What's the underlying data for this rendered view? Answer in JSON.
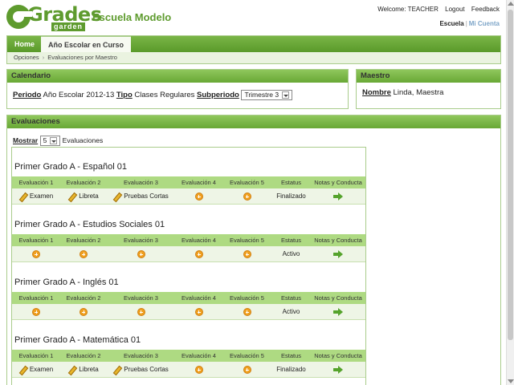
{
  "header": {
    "logo_word": "Grades",
    "logo_sub": "garden",
    "school_name": "Escuela Modelo",
    "welcome": "Welcome: TEACHER",
    "logout": "Logout",
    "feedback": "Feedback",
    "account_current": "Escuela",
    "account_separator": "|",
    "account_other": "Mi Cuenta"
  },
  "nav": {
    "tabs": [
      "Home",
      "Año Escolar en Curso"
    ],
    "breadcrumbs": [
      "Opciones",
      "Evaluaciones por Maestro"
    ],
    "crumb_arrow": "›"
  },
  "calendario": {
    "title": "Calendario",
    "periodo_label": "Periodo",
    "periodo_value": "Año Escolar 2012-13",
    "tipo_label": "Tipo",
    "tipo_value": "Clases Regulares",
    "subperiodo_label": "Subperiodo",
    "subperiodo_value": "Trimestre 3"
  },
  "maestro": {
    "title": "Maestro",
    "nombre_label": "Nombre",
    "nombre_value": "Linda, Maestra"
  },
  "evaluaciones": {
    "title": "Evaluaciones",
    "mostrar_label": "Mostrar",
    "mostrar_value": "5",
    "mostrar_suffix": "Evaluaciones",
    "columns": [
      "Evaluación 1",
      "Evaluación 2",
      "Evaluación 3",
      "Evaluación 4",
      "Evaluación 5",
      "Estatus",
      "Notas y Conducta"
    ],
    "courses": [
      {
        "title": "Primer Grado A - Español 01",
        "cells": [
          {
            "type": "text",
            "text": "Examen"
          },
          {
            "type": "text",
            "text": "Libreta"
          },
          {
            "type": "text",
            "text": "Pruebas Cortas"
          },
          {
            "type": "add"
          },
          {
            "type": "add"
          }
        ],
        "status": "Finalizado"
      },
      {
        "title": "Primer Grado A - Estudios Sociales 01",
        "cells": [
          {
            "type": "add"
          },
          {
            "type": "add"
          },
          {
            "type": "add"
          },
          {
            "type": "add"
          },
          {
            "type": "add"
          }
        ],
        "status": "Activo"
      },
      {
        "title": "Primer Grado A - Inglés 01",
        "cells": [
          {
            "type": "add"
          },
          {
            "type": "add"
          },
          {
            "type": "add"
          },
          {
            "type": "add"
          },
          {
            "type": "add"
          }
        ],
        "status": "Activo"
      },
      {
        "title": "Primer Grado A - Matemática 01",
        "cells": [
          {
            "type": "text",
            "text": "Examen"
          },
          {
            "type": "text",
            "text": "Libreta"
          },
          {
            "type": "text",
            "text": "Pruebas Cortas"
          },
          {
            "type": "add"
          },
          {
            "type": "add"
          }
        ],
        "status": "Finalizado"
      }
    ]
  }
}
